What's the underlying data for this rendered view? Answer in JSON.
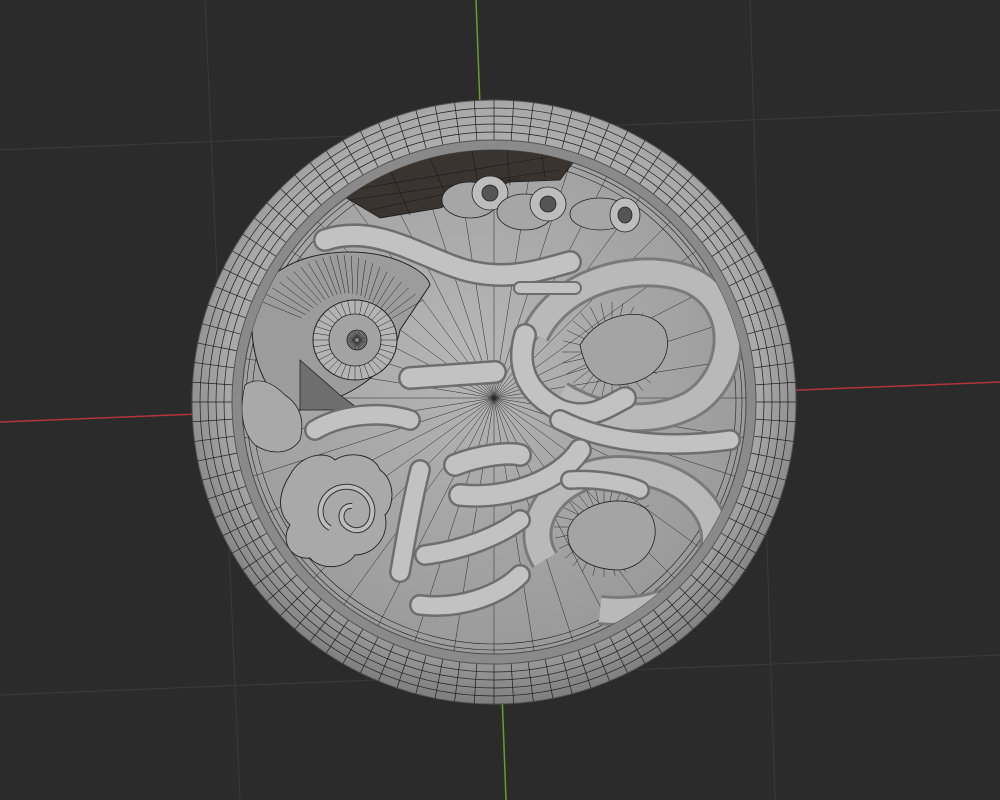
{
  "viewport": {
    "name": "3D Viewport",
    "background": "#2b2b2b",
    "grid_color": "#3a3a3a",
    "x_axis_color": "#b3343d",
    "y_axis_color": "#6b9b2a"
  },
  "model": {
    "description_icon": "mesh-object",
    "base_color": "#9a9a9a",
    "rim_color": "#a8a8a8",
    "wire_color": "#1e1e1e",
    "mode": "wireframe-overlay"
  }
}
